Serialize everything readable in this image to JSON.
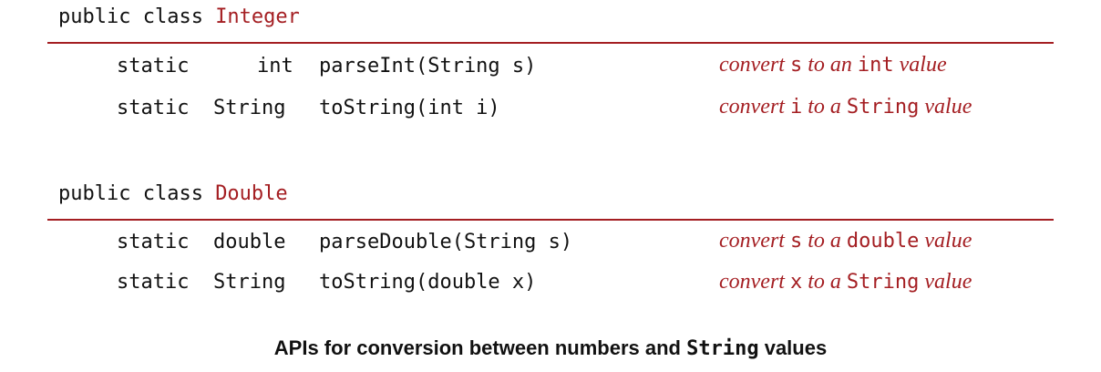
{
  "accent_color": "#a41e22",
  "apis": [
    {
      "header_prefix": "public class ",
      "class_name": "Integer",
      "methods": [
        {
          "modifier": "static",
          "return_type": "int",
          "signature": "parseInt(String s)",
          "desc": [
            "convert ",
            "s",
            " to an ",
            "int",
            " value"
          ]
        },
        {
          "modifier": "static",
          "return_type": "String",
          "signature": "toString(int i)",
          "desc": [
            "convert ",
            "i",
            " to a ",
            "String",
            " value"
          ]
        }
      ]
    },
    {
      "header_prefix": "public class ",
      "class_name": "Double",
      "methods": [
        {
          "modifier": "static",
          "return_type": "double",
          "signature": "parseDouble(String s)",
          "desc": [
            "convert ",
            "s",
            " to a ",
            "double",
            " value"
          ]
        },
        {
          "modifier": "static",
          "return_type": "String",
          "signature": "toString(double x)",
          "desc": [
            "convert ",
            "x",
            " to a ",
            "String",
            " value"
          ]
        }
      ]
    }
  ],
  "caption": {
    "before": "APIs for conversion between numbers and ",
    "code": "String",
    "after": " values"
  }
}
